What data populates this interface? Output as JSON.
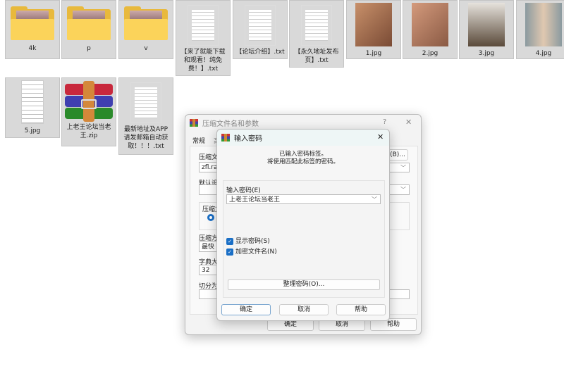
{
  "files": [
    {
      "name": "4k",
      "type": "folder"
    },
    {
      "name": "p",
      "type": "folder"
    },
    {
      "name": "v",
      "type": "folder"
    },
    {
      "name": "【来了就能下载和观看！纯免费！】.txt",
      "type": "txt"
    },
    {
      "name": "【论坛介绍】.txt",
      "type": "txt"
    },
    {
      "name": "【永久地址发布页】.txt",
      "type": "txt"
    },
    {
      "name": "1.jpg",
      "type": "image"
    },
    {
      "name": "2.jpg",
      "type": "image"
    },
    {
      "name": "3.jpg",
      "type": "image"
    },
    {
      "name": "4.jpg",
      "type": "image"
    },
    {
      "name": "5.jpg",
      "type": "image"
    },
    {
      "name": "上老王论坛当老王.zip",
      "type": "zip"
    },
    {
      "name": "最新地址及APP请发邮箱自动获取！！！.txt",
      "type": "txt"
    }
  ],
  "archive_dialog": {
    "title": "压缩文件名和参数",
    "help": "?",
    "close": "✕",
    "tab_general": "常规",
    "tab_advanced": "高",
    "archive_name_label": "压缩文件",
    "archive_name_value": "zfl.rar",
    "browse_btn": "(B)...",
    "default_settings_label": "默认设置",
    "format_label": "压缩文",
    "method_label": "压缩方式",
    "method_value": "最快",
    "dict_label": "字典大小",
    "dict_value": "32",
    "split_label": "切分为分",
    "ok": "确定",
    "cancel": "取消",
    "help_btn": "帮助"
  },
  "password_dialog": {
    "title": "输入密码",
    "close": "✕",
    "message_line1": "已输入密码标签。",
    "message_line2": "将使用匹配此标签的密码。",
    "password_label": "输入密码(E)",
    "password_value": "上老王论坛当老王",
    "show_password": "显示密码(S)",
    "encrypt_names": "加密文件名(N)",
    "organize": "整理密码(O)...",
    "ok": "确定",
    "cancel": "取消",
    "help": "帮助"
  }
}
